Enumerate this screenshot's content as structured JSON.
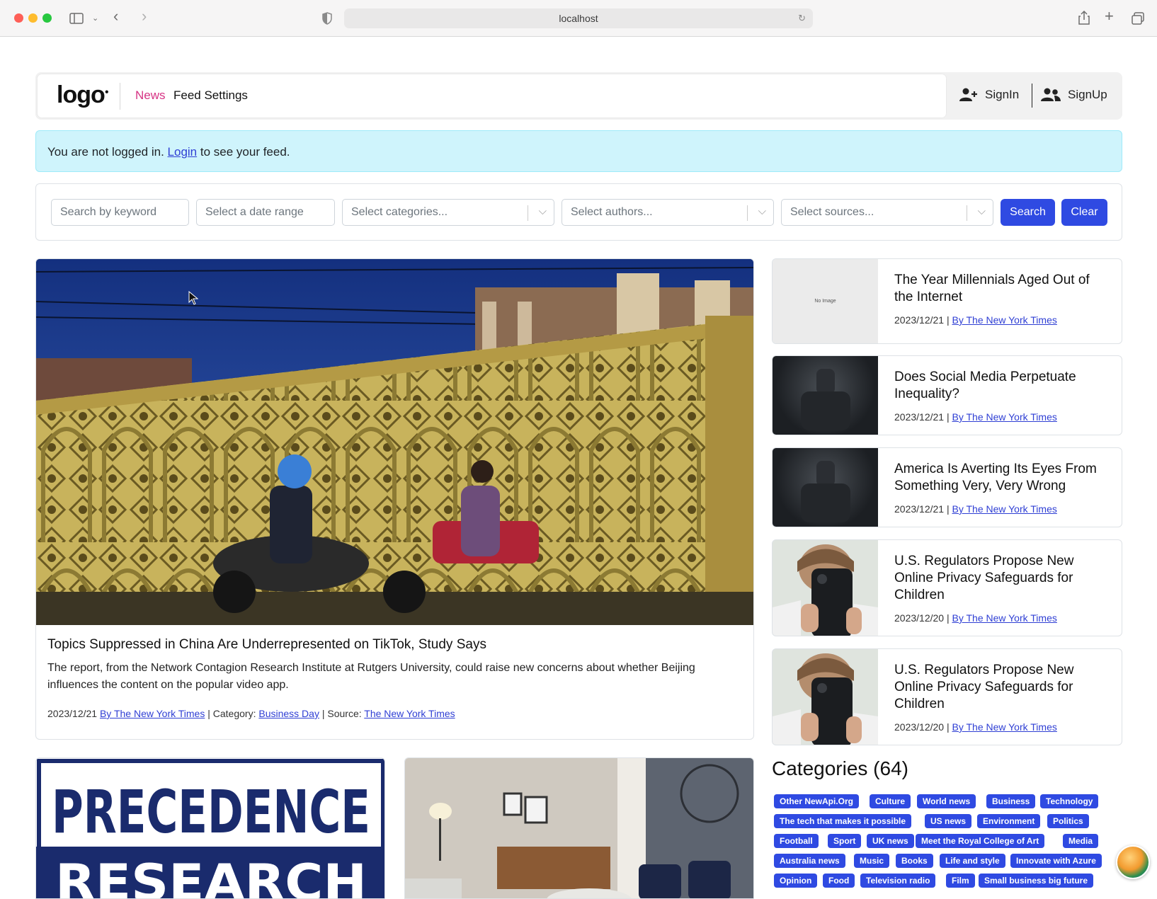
{
  "browser": {
    "url": "localhost"
  },
  "nav": {
    "logo": "logo",
    "links": [
      "News",
      "Feed Settings"
    ],
    "signin": "SignIn",
    "signup": "SignUp"
  },
  "alert": {
    "prefix": "You are not logged in.",
    "link": "Login",
    "suffix": "to see your feed."
  },
  "filters": {
    "keyword_placeholder": "Search by keyword",
    "date_placeholder": "Select a date range",
    "categories_placeholder": "Select categories...",
    "authors_placeholder": "Select authors...",
    "sources_placeholder": "Select sources...",
    "search_label": "Search",
    "clear_label": "Clear"
  },
  "hero": {
    "title": "Topics Suppressed in China Are Underrepresented on TikTok, Study Says",
    "description": "The report, from the Network Contagion Research Institute at Rutgers University, could raise new concerns about whether Beijing influences the content on the popular video app.",
    "date": "2023/12/21",
    "author": "By The New York Times",
    "category_label": "Category:",
    "category": "Business Day",
    "source_label": "Source:",
    "source": "The New York Times"
  },
  "side_articles": [
    {
      "title": "The Year Millennials Aged Out of the Internet",
      "date": "2023/12/21",
      "author": "By The New York Times",
      "thumb": "No Image"
    },
    {
      "title": "Does Social Media Perpetuate Inequality?",
      "date": "2023/12/21",
      "author": "By The New York Times"
    },
    {
      "title": "America Is Averting Its Eyes From Something Very, Very Wrong",
      "date": "2023/12/21",
      "author": "By The New York Times"
    },
    {
      "title": "U.S. Regulators Propose New Online Privacy Safeguards for Children",
      "date": "2023/12/20",
      "author": "By The New York Times"
    },
    {
      "title": "U.S. Regulators Propose New Online Privacy Safeguards for Children",
      "date": "2023/12/20",
      "author": "By The New York Times"
    }
  ],
  "bottom": {
    "precedence_text": "PRECEDENCE",
    "research_text": "RESEARCH"
  },
  "categories": {
    "title": "Categories (64)",
    "tags": [
      "Other NewApi.Org",
      "Culture",
      "World news",
      "Business",
      "Technology",
      "The tech that makes it possible",
      "US news",
      "Environment",
      "Politics",
      "Football",
      "Sport",
      "UK news",
      "Meet the Royal College of Art",
      "Media",
      "Australia news",
      "Music",
      "Books",
      "Life and style",
      "Innovate with Azure",
      "Opinion",
      "Food",
      "Television radio",
      "Film",
      "Small business big future"
    ]
  }
}
